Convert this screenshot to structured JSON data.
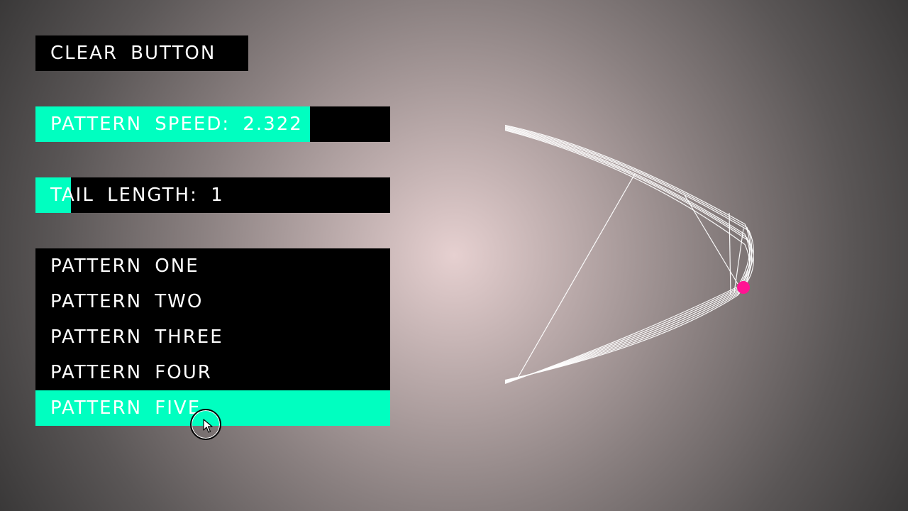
{
  "clear_button": {
    "label": "CLEAR BUTTON"
  },
  "speed_slider": {
    "label": "PATTERN SPEED: 2.322",
    "fill_fraction": 0.774
  },
  "tail_slider": {
    "label": "TAIL LENGTH: 1",
    "fill_fraction": 0.1
  },
  "patterns": {
    "items": [
      {
        "label": "PATTERN ONE"
      },
      {
        "label": "PATTERN TWO"
      },
      {
        "label": "PATTERN THREE"
      },
      {
        "label": "PATTERN FOUR"
      },
      {
        "label": "PATTERN FIVE"
      }
    ],
    "selected_index": 4
  },
  "colors": {
    "accent": "#00ffc0",
    "panel": "#000000",
    "text": "#ffffff",
    "trail": "#ffffff",
    "dot": "#ff1493"
  },
  "icons": {
    "cursor": "mouse-pointer-icon"
  }
}
